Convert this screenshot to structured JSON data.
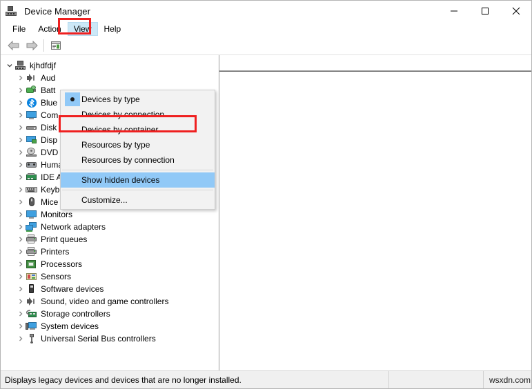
{
  "window": {
    "title": "Device Manager",
    "icon": "device-manager-icon",
    "controls": {
      "minimize": "─",
      "maximize": "□",
      "close": "✕"
    }
  },
  "menubar": {
    "items": [
      {
        "label": "File",
        "open": false
      },
      {
        "label": "Action",
        "open": false
      },
      {
        "label": "View",
        "open": true
      },
      {
        "label": "Help",
        "open": false
      }
    ]
  },
  "toolbar": {
    "buttons": [
      {
        "name": "back-button",
        "icon": "left-arrow-icon"
      },
      {
        "name": "forward-button",
        "icon": "right-arrow-icon"
      },
      {
        "name": "properties-button",
        "icon": "properties-icon"
      }
    ]
  },
  "view_menu": {
    "items": [
      {
        "label": "Devices by type",
        "checked": true,
        "highlighted": false,
        "separator_after": false
      },
      {
        "label": "Devices by connection",
        "checked": false,
        "highlighted": false,
        "separator_after": false
      },
      {
        "label": "Devices by container",
        "checked": false,
        "highlighted": false,
        "separator_after": false
      },
      {
        "label": "Resources by type",
        "checked": false,
        "highlighted": false,
        "separator_after": false
      },
      {
        "label": "Resources by connection",
        "checked": false,
        "highlighted": false,
        "separator_after": true
      },
      {
        "label": "Show hidden devices",
        "checked": false,
        "highlighted": true,
        "separator_after": true
      },
      {
        "label": "Customize...",
        "checked": false,
        "highlighted": false,
        "separator_after": false
      }
    ]
  },
  "annotations": {
    "view_box_color": "#ef2020",
    "highlight_box_color": "#ef2020",
    "menu_highlight_color": "#91c9f7"
  },
  "tree": {
    "root": {
      "label": "kjhdfdjf",
      "expanded": true,
      "icon": "computer-icon"
    },
    "items": [
      {
        "label": "Aud",
        "icon": "audio-icon",
        "truncated": true
      },
      {
        "label": "Batt",
        "icon": "battery-icon",
        "truncated": true
      },
      {
        "label": "Blue",
        "icon": "bluetooth-icon",
        "truncated": true
      },
      {
        "label": "Com",
        "icon": "monitor-icon",
        "truncated": true
      },
      {
        "label": "Disk",
        "icon": "disk-icon",
        "truncated": true
      },
      {
        "label": "Disp",
        "icon": "display-icon",
        "truncated": true
      },
      {
        "label": "DVD",
        "icon": "dvd-icon",
        "truncated": true
      },
      {
        "label": "Human Interface Devices",
        "icon": "hid-icon",
        "truncated": false
      },
      {
        "label": "IDE ATA/ATAPI controllers",
        "icon": "ide-icon",
        "truncated": false
      },
      {
        "label": "Keyboards",
        "icon": "keyboard-icon",
        "truncated": false
      },
      {
        "label": "Mice and other pointing devices",
        "icon": "mouse-icon",
        "truncated": false
      },
      {
        "label": "Monitors",
        "icon": "monitor-icon",
        "truncated": false
      },
      {
        "label": "Network adapters",
        "icon": "network-icon",
        "truncated": false
      },
      {
        "label": "Print queues",
        "icon": "printer-icon",
        "truncated": false
      },
      {
        "label": "Printers",
        "icon": "printer-icon",
        "truncated": false
      },
      {
        "label": "Processors",
        "icon": "processor-icon",
        "truncated": false
      },
      {
        "label": "Sensors",
        "icon": "sensor-icon",
        "truncated": false
      },
      {
        "label": "Software devices",
        "icon": "software-icon",
        "truncated": false
      },
      {
        "label": "Sound, video and game controllers",
        "icon": "sound-icon",
        "truncated": false
      },
      {
        "label": "Storage controllers",
        "icon": "storage-icon",
        "truncated": false
      },
      {
        "label": "System devices",
        "icon": "system-icon",
        "truncated": false
      },
      {
        "label": "Universal Serial Bus controllers",
        "icon": "usb-icon",
        "truncated": false
      }
    ]
  },
  "statusbar": {
    "message": "Displays legacy devices and devices that are no longer installed.",
    "middle": "",
    "watermark": "wsxdn.com"
  }
}
